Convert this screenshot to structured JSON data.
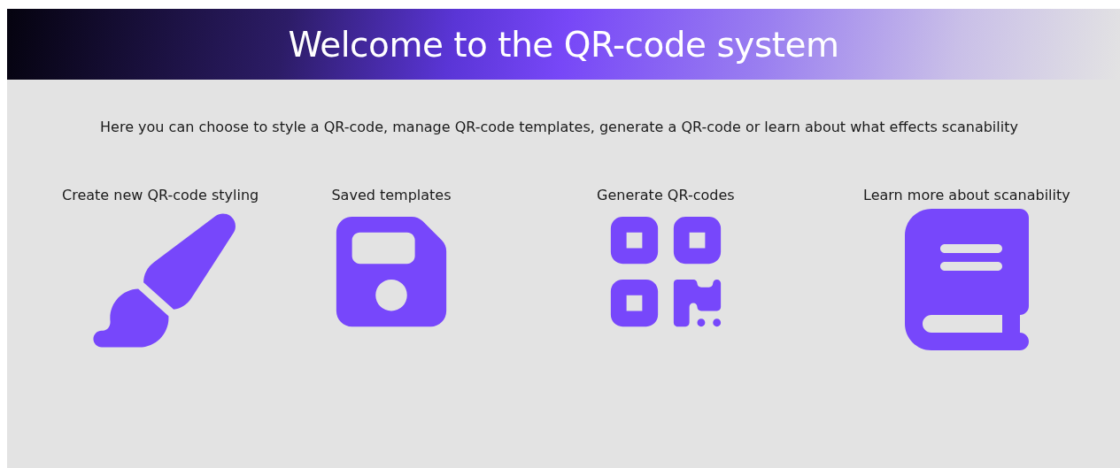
{
  "header": {
    "title": "Welcome to the QR-code system"
  },
  "intro": "Here you can choose to style a QR-code, manage QR-code templates, generate a QR-code or learn about what effects scanability",
  "options": [
    {
      "label": "Create new QR-code styling"
    },
    {
      "label": "Saved templates"
    },
    {
      "label": "Generate QR-codes"
    },
    {
      "label": "Learn more about scanability"
    }
  ]
}
